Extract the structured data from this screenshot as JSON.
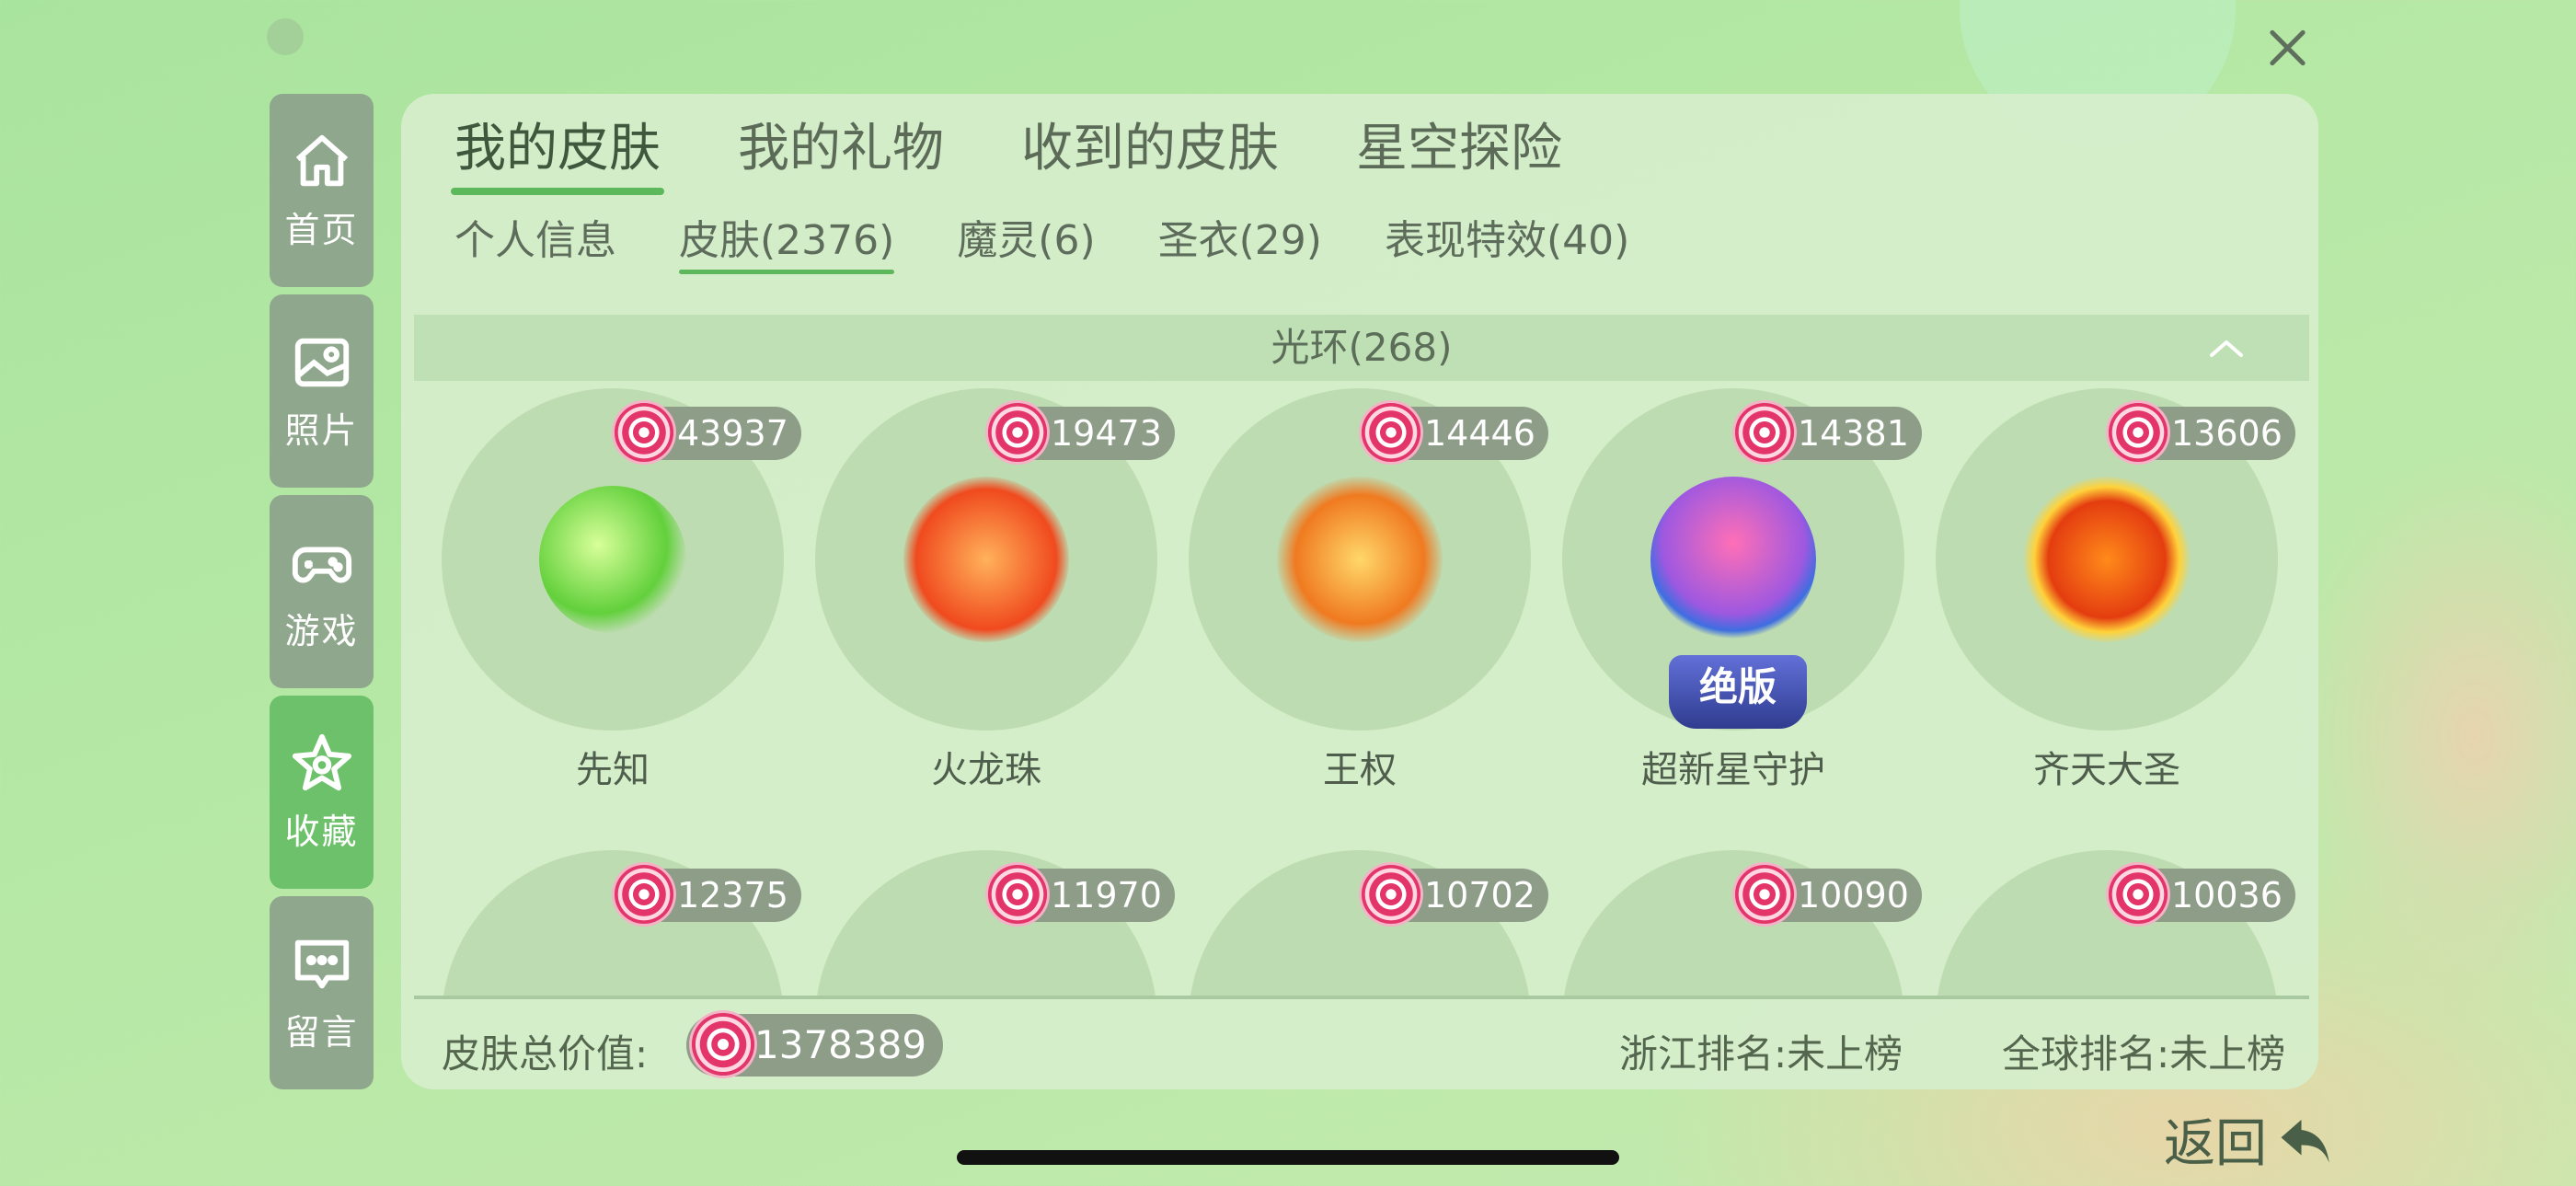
{
  "sidebar": {
    "items": [
      {
        "label": "首页",
        "icon": "home-icon"
      },
      {
        "label": "照片",
        "icon": "image-icon"
      },
      {
        "label": "游戏",
        "icon": "gamepad-icon"
      },
      {
        "label": "收藏",
        "icon": "star-icon",
        "active": true
      },
      {
        "label": "留言",
        "icon": "message-icon"
      }
    ]
  },
  "tabs": {
    "main": [
      "我的皮肤",
      "我的礼物",
      "收到的皮肤",
      "星空探险"
    ],
    "main_active": "我的皮肤",
    "sub": [
      "个人信息",
      "皮肤(2376)",
      "魔灵(6)",
      "圣衣(29)",
      "表现特效(40)"
    ],
    "sub_active": "皮肤(2376)"
  },
  "group": {
    "title": "光环(268)"
  },
  "items_row1": [
    {
      "name": "先知",
      "value": "43937"
    },
    {
      "name": "火龙珠",
      "value": "19473"
    },
    {
      "name": "王权",
      "value": "14446"
    },
    {
      "name": "超新星守护",
      "value": "14381",
      "tag": "绝版"
    },
    {
      "name": "齐天大圣",
      "value": "13606"
    }
  ],
  "items_row2": [
    {
      "value": "12375"
    },
    {
      "value": "11970"
    },
    {
      "value": "10702"
    },
    {
      "value": "10090"
    },
    {
      "value": "10036"
    }
  ],
  "footer": {
    "total_label": "皮肤总价值:",
    "total_value": "1378389",
    "local_rank": "浙江排名:未上榜",
    "global_rank": "全球排名:未上榜"
  },
  "back_label": "返回",
  "colors": {
    "accent": "#5cb85a",
    "panel": "#d6eecc",
    "sidebar": "#8fa78c",
    "sidebar_active": "#6cc16a",
    "badge": "#8d9d88"
  }
}
